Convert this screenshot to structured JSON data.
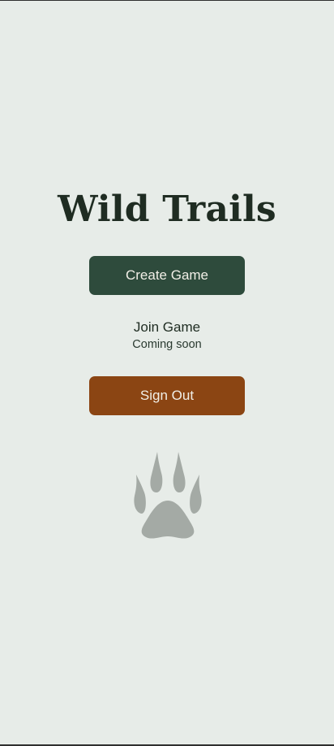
{
  "app": {
    "title": "Wild Trails"
  },
  "actions": {
    "create_game_label": "Create Game",
    "join_game_label": "Join Game",
    "join_game_status": "Coming soon",
    "sign_out_label": "Sign Out"
  },
  "colors": {
    "background": "#e7ece8",
    "primary_button": "#2e4b3c",
    "secondary_button": "#8b4513",
    "title_text": "#1f2c22",
    "icon": "#a4aaa5"
  },
  "icons": {
    "paw": "paw-print-icon"
  }
}
